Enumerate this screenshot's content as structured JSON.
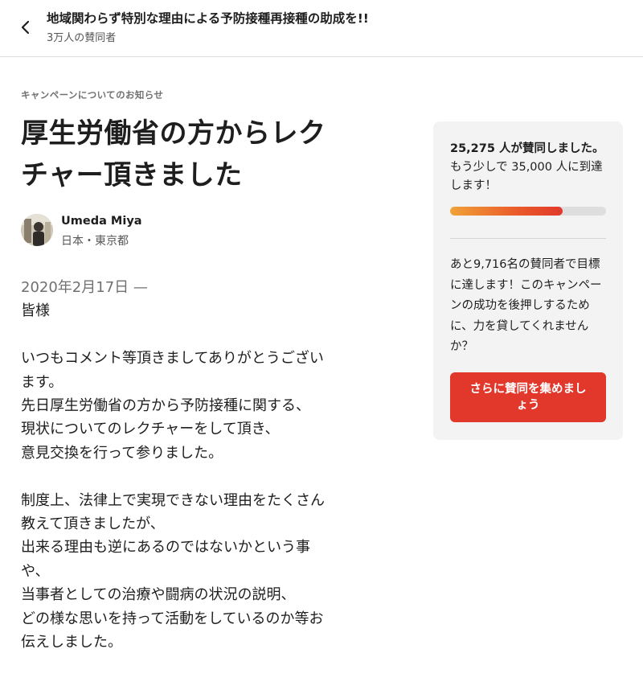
{
  "header": {
    "title": "地域関わらず特別な理由による予防接種再接種の助成を!!",
    "subtitle": "3万人の賛同者"
  },
  "post": {
    "kicker": "キャンペーンについてのお知らせ",
    "title_line1": "厚生労働省の方からレク",
    "title_line2": "チャー頂きました",
    "author": {
      "name": "Umeda Miya",
      "location": "日本・東京都"
    },
    "date": "2020年2月17日 —",
    "greeting": "皆様",
    "paragraph1": "いつもコメント等頂きましてありがとうござい\nます。\n先日厚生労働省の方から予防接種に関する、\n現状についてのレクチャーをして頂き、\n意見交換を行って参りました。",
    "paragraph2": "制度上、法律上で実現できない理由をたくさん\n教えて頂きましたが、\n出来る理由も逆にあるのではないかという事\nや、\n当事者としての治療や闘病の状況の説明、\nどの様な思いを持って活動をしているのか等お\n伝えしました。"
  },
  "sidebar": {
    "supporters_bold": "25,275 人が賛同しました。",
    "supporters_rest": "もう少しで 35,000 人に到達します！",
    "progress_fraction": 0.72,
    "goal_text": "あと9,716名の賛同者で目標に達します！このキャンペーンの成功を後押しするために、力を貸してくれませんか？",
    "cta_label": "さらに賛同を集めましょう"
  },
  "colors": {
    "accent": "#e2382c",
    "progress_start": "#f0a238",
    "panel_bg": "#f3f3f3"
  },
  "icons": {
    "back": "chevron-left-icon",
    "avatar": "user-photo"
  }
}
